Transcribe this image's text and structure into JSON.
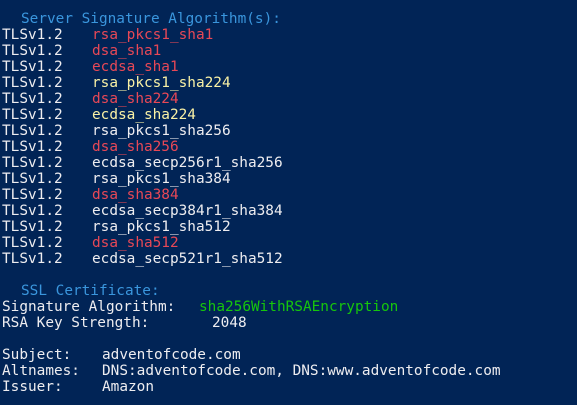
{
  "terminal": {
    "sig_header": "Server Signature Algorithm(s):",
    "algorithms": [
      {
        "proto": "TLSv1.2",
        "name": "rsa_pkcs1_sha1",
        "color": "#e74856"
      },
      {
        "proto": "TLSv1.2",
        "name": "dsa_sha1",
        "color": "#e74856"
      },
      {
        "proto": "TLSv1.2",
        "name": "ecdsa_sha1",
        "color": "#e74856"
      },
      {
        "proto": "TLSv1.2",
        "name": "rsa_pkcs1_sha224",
        "color": "#f9f1a5"
      },
      {
        "proto": "TLSv1.2",
        "name": "dsa_sha224",
        "color": "#e74856"
      },
      {
        "proto": "TLSv1.2",
        "name": "ecdsa_sha224",
        "color": "#f9f1a5"
      },
      {
        "proto": "TLSv1.2",
        "name": "rsa_pkcs1_sha256",
        "color": "#eeedf0"
      },
      {
        "proto": "TLSv1.2",
        "name": "dsa_sha256",
        "color": "#e74856"
      },
      {
        "proto": "TLSv1.2",
        "name": "ecdsa_secp256r1_sha256",
        "color": "#eeedf0"
      },
      {
        "proto": "TLSv1.2",
        "name": "rsa_pkcs1_sha384",
        "color": "#eeedf0"
      },
      {
        "proto": "TLSv1.2",
        "name": "dsa_sha384",
        "color": "#e74856"
      },
      {
        "proto": "TLSv1.2",
        "name": "ecdsa_secp384r1_sha384",
        "color": "#eeedf0"
      },
      {
        "proto": "TLSv1.2",
        "name": "rsa_pkcs1_sha512",
        "color": "#eeedf0"
      },
      {
        "proto": "TLSv1.2",
        "name": "dsa_sha512",
        "color": "#e74856"
      },
      {
        "proto": "TLSv1.2",
        "name": "ecdsa_secp521r1_sha512",
        "color": "#eeedf0"
      }
    ],
    "ssl_header": "SSL Certificate:",
    "signature_algorithm_label": "Signature Algorithm:",
    "signature_algorithm_value": "sha256WithRSAEncryption",
    "rsa_key_strength_label": "RSA Key Strength:",
    "rsa_key_strength_value": "2048",
    "subject_label": "Subject:",
    "subject_value": "adventofcode.com",
    "altnames_label": "Altnames:",
    "altnames_value": "DNS:adventofcode.com, DNS:www.adventofcode.com",
    "issuer_label": "Issuer:",
    "issuer_value": "Amazon"
  },
  "colors": {
    "background": "#012456",
    "default_text": "#eeedf0",
    "header": "#3a96dd",
    "weak": "#e74856",
    "medium": "#f9f1a5",
    "strong": "#16c60c"
  }
}
